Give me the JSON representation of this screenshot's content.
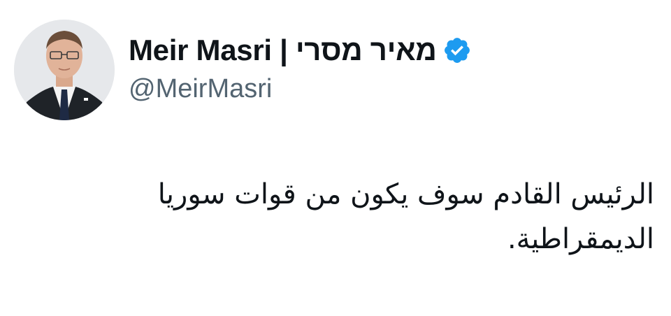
{
  "author": {
    "display_name": "Meir Masri | מאיר מסרי",
    "handle": "@MeirMasri",
    "verified": true,
    "avatar_icon": "profile-photo"
  },
  "tweet": {
    "text": "الرئيس القادم سوف يكون من قوات سوريا\nالديمقراطية."
  },
  "colors": {
    "verified_badge": "#1d9bf0",
    "handle": "#536471",
    "text": "#0f1419"
  }
}
